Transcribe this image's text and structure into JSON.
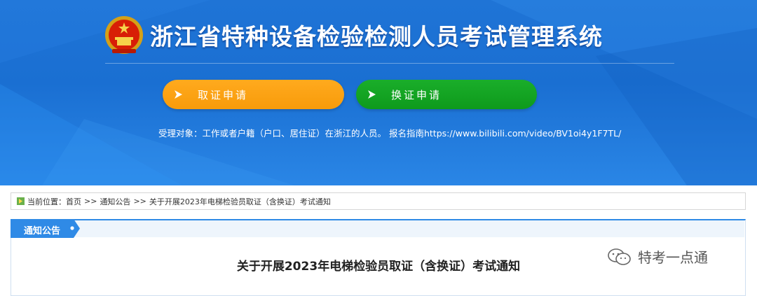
{
  "header": {
    "site_title": "浙江省特种设备检验检测人员考试管理系统",
    "emblem_icon": "national-emblem-icon"
  },
  "actions": {
    "apply_label": "取证申请",
    "renew_label": "换证申请",
    "apply_color": "#f89b0a",
    "renew_color": "#0e9a1c"
  },
  "notice": {
    "text": "受理对象：工作或者户籍（户口、居住证）在浙江的人员。 报名指南https://www.bilibili.com/video/BV1oi4y1F7TL/"
  },
  "breadcrumb": {
    "prefix": "当前位置：",
    "home": "首页",
    "sep1": ">>",
    "section": "通知公告",
    "sep2": ">>",
    "current": "关于开展2023年电梯检验员取证（含换证）考试通知"
  },
  "panel": {
    "tab_label": "通知公告"
  },
  "article": {
    "title": "关于开展2023年电梯检验员取证（含换证）考试通知"
  },
  "watermark": {
    "text": "特考一点通"
  },
  "colors": {
    "banner_blue": "#1f74d6",
    "tab_blue": "#2f8ae6"
  }
}
